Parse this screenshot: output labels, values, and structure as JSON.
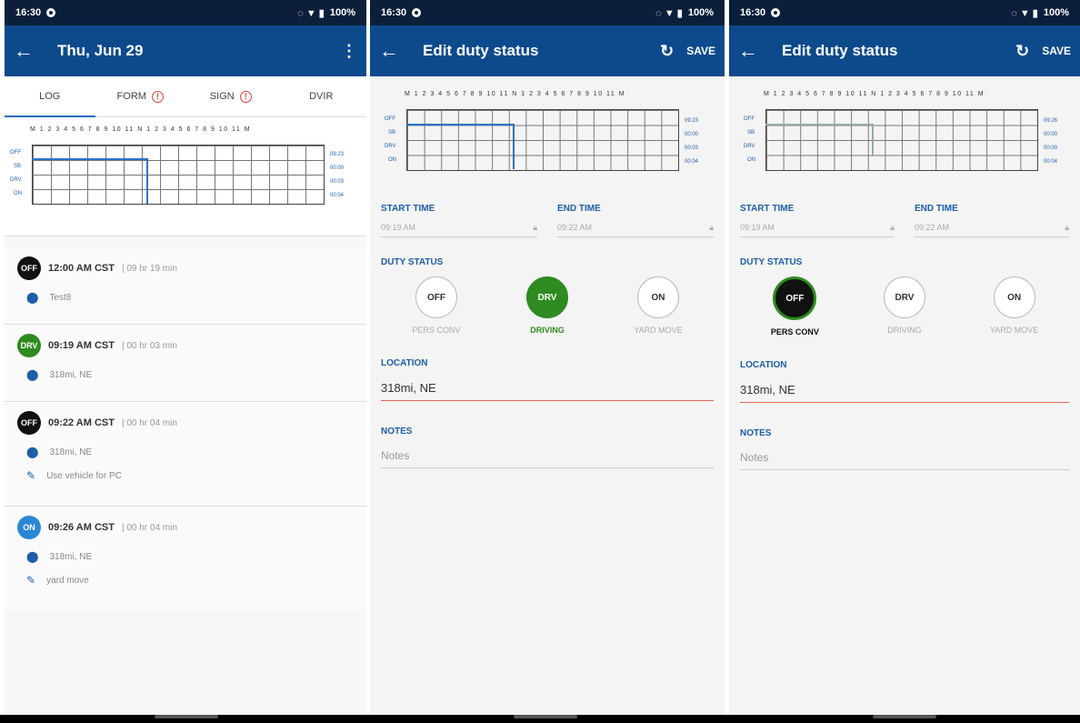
{
  "status_bar": {
    "time": "16:30",
    "battery": "100%"
  },
  "screen1": {
    "title": "Thu, Jun 29",
    "tabs": [
      "LOG",
      "FORM",
      "SIGN",
      "DVIR"
    ],
    "graph": {
      "hours": "M 1 2 3 4 5 6 7 8 9 10 11 N 1 2 3 4 5 6 7 8 9 10 11 M",
      "rows": [
        "OFF",
        "SB",
        "DRV",
        "ON"
      ],
      "totals": [
        "09:23",
        "00:00",
        "00:03",
        "00:04"
      ]
    },
    "events": [
      {
        "badge": "OFF",
        "time": "12:00 AM CST",
        "duration": "| 09 hr 19 min",
        "location": "Test8",
        "note": ""
      },
      {
        "badge": "DRV",
        "time": "09:19 AM CST",
        "duration": "| 00 hr 03 min",
        "location": "318mi, NE",
        "note": ""
      },
      {
        "badge": "OFF",
        "time": "09:22 AM CST",
        "duration": "| 00 hr 04 min",
        "location": "318mi, NE",
        "note": "Use vehicle for PC"
      },
      {
        "badge": "ON",
        "time": "09:26 AM CST",
        "duration": "| 00 hr 04 min",
        "location": "318mi, NE",
        "note": "yard move"
      }
    ]
  },
  "screen2": {
    "title": "Edit duty status",
    "save": "SAVE",
    "hours": "M 1 2 3 4 5 6 7 8 9 10 11 N 1 2 3 4 5 6 7 8 9 10 11 M",
    "rows": [
      "OFF",
      "SB",
      "DRV",
      "ON"
    ],
    "totals": [
      "09:23",
      "00:00",
      "00:03",
      "00:04"
    ],
    "start_time_label": "START TIME",
    "start_time": "09:19 AM",
    "end_time_label": "END TIME",
    "end_time": "09:22 AM",
    "duty_status_label": "DUTY STATUS",
    "statuses": [
      {
        "code": "OFF",
        "label": "PERS CONV"
      },
      {
        "code": "DRV",
        "label": "DRIVING"
      },
      {
        "code": "ON",
        "label": "YARD MOVE"
      }
    ],
    "location_label": "LOCATION",
    "location": "318mi, NE",
    "notes_label": "NOTES",
    "notes_placeholder": "Notes"
  },
  "screen3": {
    "title": "Edit duty status",
    "save": "SAVE",
    "hours": "M 1 2 3 4 5 6 7 8 9 10 11 N 1 2 3 4 5 6 7 8 9 10 11 M",
    "rows": [
      "OFF",
      "SB",
      "DRV",
      "ON"
    ],
    "totals": [
      "09:26",
      "00:00",
      "00:00",
      "00:04"
    ],
    "start_time_label": "START TIME",
    "start_time": "09:19 AM",
    "end_time_label": "END TIME",
    "end_time": "09:22 AM",
    "duty_status_label": "DUTY STATUS",
    "statuses": [
      {
        "code": "OFF",
        "label": "PERS CONV"
      },
      {
        "code": "DRV",
        "label": "DRIVING"
      },
      {
        "code": "ON",
        "label": "YARD MOVE"
      }
    ],
    "location_label": "LOCATION",
    "location": "318mi, NE",
    "notes_label": "NOTES",
    "notes_placeholder": "Notes"
  },
  "colors": {
    "appbar": "#0d4a8c",
    "statusbar": "#0b1f3a",
    "driving": "#2e8b1f",
    "on_duty": "#2b86d6",
    "accent": "#1d5ea8",
    "error_underline": "#e06a5a"
  }
}
